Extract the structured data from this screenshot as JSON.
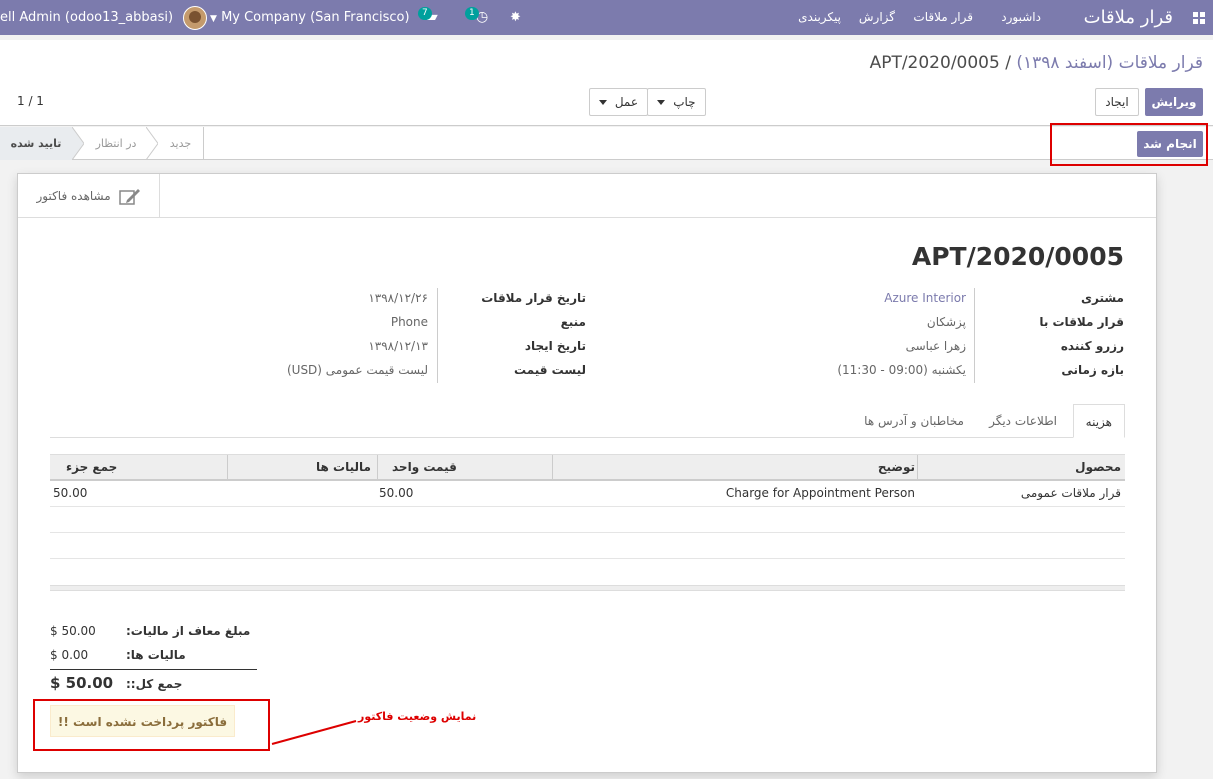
{
  "navbar": {
    "brand": "قرار ملاقات",
    "menu": [
      "داشبورد",
      "قرار ملاقات",
      "گزارش",
      "پیکربندی"
    ],
    "user": "ell Admin (odoo13_abbasi)",
    "company": "My Company (San Francisco)",
    "messages_count": "7",
    "activities_count": "1"
  },
  "breadcrumb": {
    "parent": "قرار ملاقات (اسفند ۱۳۹۸)",
    "separator": "/",
    "current": "APT/2020/0005"
  },
  "buttons": {
    "edit": "ویرایش",
    "create": "ایجاد",
    "print": "چاپ",
    "action": "عمل",
    "done": "انجام شد"
  },
  "pager": "1 / 1",
  "statusbar": {
    "confirmed": "تایید شده",
    "pending": "در انتظار",
    "new": "جدید"
  },
  "smart_button": "مشاهده فاکتور",
  "record": {
    "name": "APT/2020/0005",
    "left_fields": [
      {
        "label": "مشتری",
        "value": "Azure Interior"
      },
      {
        "label": "قرار ملاقات با",
        "value": "پزشکان"
      },
      {
        "label": "رزرو کننده",
        "value": "زهرا عباسی"
      },
      {
        "label": "بازه زمانی",
        "value": "یکشنبه (09:00 - 11:30)"
      }
    ],
    "right_fields": [
      {
        "label": "تاریخ قرار ملاقات",
        "value": "۱۳۹۸/۱۲/۲۶"
      },
      {
        "label": "منبع",
        "value": "Phone"
      },
      {
        "label": "تاریخ ایجاد",
        "value": "۱۳۹۸/۱۲/۱۳"
      },
      {
        "label": "لیست قیمت",
        "value": "لیست قیمت عمومی (USD)"
      }
    ]
  },
  "tabs": [
    "هزینه",
    "اطلاعات دیگر",
    "مخاطبان و آدرس ها"
  ],
  "table": {
    "headers": [
      "محصول",
      "توضیح",
      "قیمت واحد",
      "مالیات ها",
      "جمع جزء"
    ],
    "rows": [
      {
        "product": "قرار ملاقات عمومی",
        "description": "Charge for Appointment Person",
        "unit_price": "50.00",
        "taxes": "",
        "subtotal": "50.00"
      }
    ]
  },
  "totals": {
    "untaxed_label": "مبلغ معاف از مالیات:",
    "untaxed_value": "$ 50.00",
    "taxes_label": "مالیات ها:",
    "taxes_value": "$ 0.00",
    "total_label": "جمع کل::",
    "total_value": "$ 50.00"
  },
  "alert": "فاکتور پرداخت نشده است !!",
  "annotation": "نمایش وضعیت فاکتور",
  "colors": {
    "brand": "#7c7bad",
    "annotation": "#dd0000",
    "alert_bg": "#fcf8e3"
  }
}
